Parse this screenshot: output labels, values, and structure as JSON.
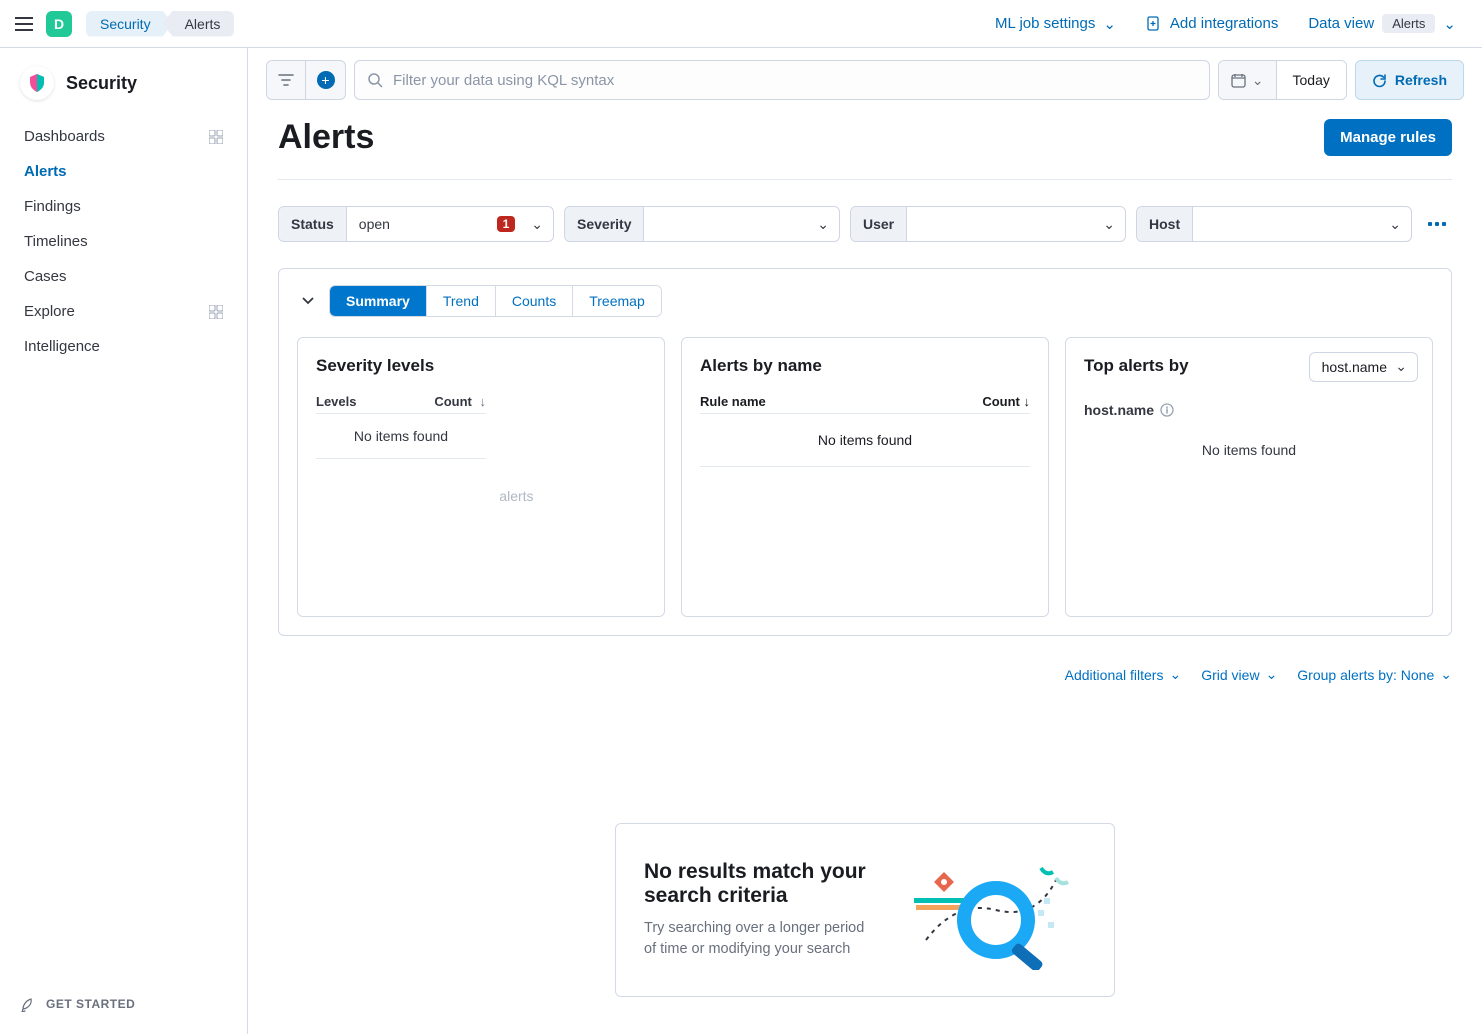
{
  "header": {
    "space_letter": "D",
    "breadcrumbs": [
      "Security",
      "Alerts"
    ],
    "ml_job_settings": "ML job settings",
    "add_integrations": "Add integrations",
    "data_view_label": "Data view",
    "data_view_value": "Alerts"
  },
  "sidebar": {
    "title": "Security",
    "items": [
      {
        "label": "Dashboards",
        "has_grid": true
      },
      {
        "label": "Alerts",
        "active": true
      },
      {
        "label": "Findings"
      },
      {
        "label": "Timelines"
      },
      {
        "label": "Cases"
      },
      {
        "label": "Explore",
        "has_grid": true
      },
      {
        "label": "Intelligence"
      }
    ],
    "get_started": "GET STARTED"
  },
  "filterbar": {
    "search_placeholder": "Filter your data using KQL syntax",
    "date_label": "Today",
    "refresh": "Refresh"
  },
  "page": {
    "title": "Alerts",
    "manage_rules": "Manage rules"
  },
  "filters": {
    "status": {
      "label": "Status",
      "value": "open",
      "badge": "1"
    },
    "severity": {
      "label": "Severity",
      "value": ""
    },
    "user": {
      "label": "User",
      "value": ""
    },
    "host": {
      "label": "Host",
      "value": ""
    }
  },
  "overview": {
    "tabs": [
      "Summary",
      "Trend",
      "Counts",
      "Treemap"
    ],
    "active_tab": "Summary",
    "severity_panel": {
      "title": "Severity levels",
      "col_levels": "Levels",
      "col_count": "Count",
      "empty": "No items found",
      "ghost": "alerts"
    },
    "byname_panel": {
      "title": "Alerts by name",
      "col_rule": "Rule name",
      "col_count": "Count",
      "empty": "No items found"
    },
    "top_panel": {
      "title": "Top alerts by",
      "select_value": "host.name",
      "field_label": "host.name",
      "empty": "No items found"
    }
  },
  "list_toolbar": {
    "additional_filters": "Additional filters",
    "grid_view": "Grid view",
    "group_by": "Group alerts by: None"
  },
  "empty_state": {
    "title": "No results match your search criteria",
    "desc": "Try searching over a longer period of time or modifying your search"
  }
}
